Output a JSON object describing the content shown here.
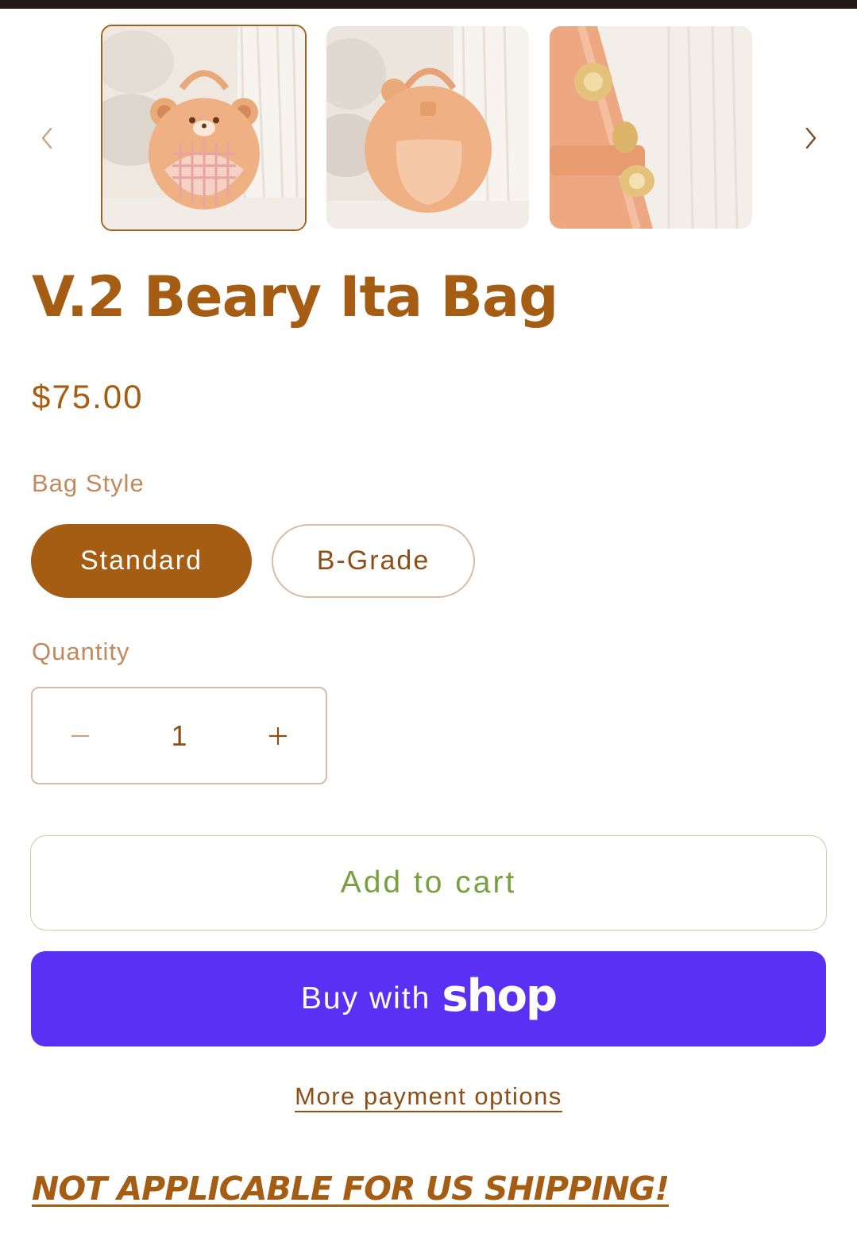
{
  "gallery": {
    "prev_icon": "chevron-left-icon",
    "next_icon": "chevron-right-icon",
    "thumbnails": [
      {
        "name": "bear-bag-front-photo",
        "selected": true
      },
      {
        "name": "bear-bag-back-photo",
        "selected": false
      },
      {
        "name": "bear-bag-zipper-detail-photo",
        "selected": false
      }
    ]
  },
  "product": {
    "title": "V.2 Beary Ita Bag",
    "price": "$75.00"
  },
  "variant": {
    "label": "Bag Style",
    "options": [
      "Standard",
      "B-Grade"
    ],
    "selected": "Standard"
  },
  "quantity": {
    "label": "Quantity",
    "value": "1",
    "decrease_icon": "minus-icon",
    "increase_icon": "plus-icon"
  },
  "actions": {
    "add_to_cart": "Add to cart",
    "buy_with": "Buy with",
    "shop_brand": "shop",
    "more_payment": "More payment options"
  },
  "notice": "NOT APPLICABLE FOR US SHIPPING!",
  "colors": {
    "brand": "#a55c13",
    "label": "#c08a5c",
    "add_to_cart_text": "#79a03f",
    "shop_pay": "#5a31f4",
    "top_bar": "#231a17"
  }
}
